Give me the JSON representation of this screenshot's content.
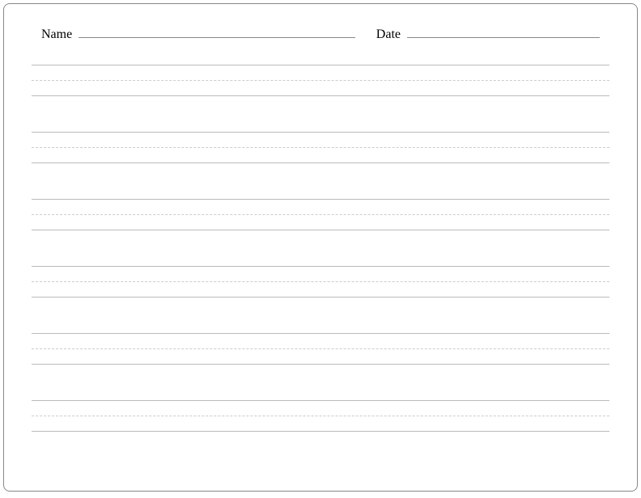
{
  "header": {
    "name_label": "Name",
    "date_label": "Date",
    "name_value": "",
    "date_value": ""
  },
  "writing_lines_count": 6
}
